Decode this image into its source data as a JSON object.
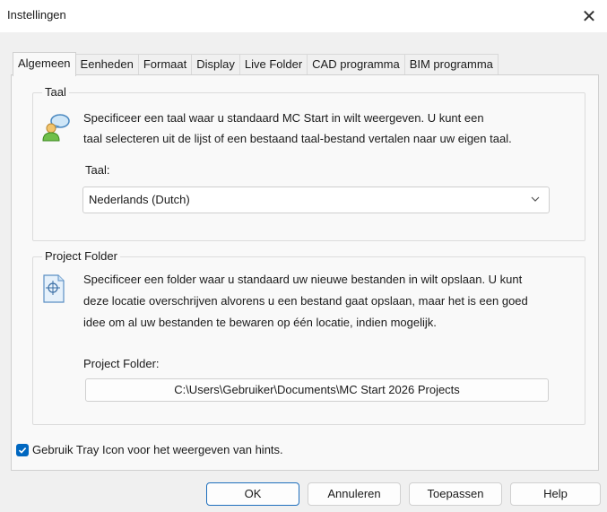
{
  "window": {
    "title": "Instellingen",
    "close_glyph": "✕"
  },
  "tabs": [
    {
      "label": "Algemeen",
      "active": true
    },
    {
      "label": "Eenheden"
    },
    {
      "label": "Formaat"
    },
    {
      "label": "Display"
    },
    {
      "label": "Live Folder"
    },
    {
      "label": "CAD programma"
    },
    {
      "label": "BIM programma"
    }
  ],
  "language": {
    "group_title": "Taal",
    "icon": "users-speech-icon",
    "desc_line1": "Specificeer een taal waar u standaard MC Start in wilt weergeven. U kunt een",
    "desc_line2": "taal selecteren uit de lijst of een bestaand taal-bestand vertalen naar uw eigen taal.",
    "field_label": "Taal:",
    "selected": "Nederlands (Dutch)"
  },
  "project": {
    "group_title": "Project Folder",
    "icon": "document-target-icon",
    "desc_line1": "Specificeer een folder waar u standaard uw nieuwe bestanden in wilt opslaan. U kunt",
    "desc_line2": "deze locatie overschrijven alvorens u een bestand gaat opslaan, maar het is een goed",
    "desc_line3": "idee om al uw bestanden te bewaren op één locatie, indien mogelijk.",
    "field_label": "Project Folder:",
    "path": "C:\\Users\\Gebruiker\\Documents\\MC Start 2026 Projects"
  },
  "tray": {
    "label": "Gebruik Tray Icon voor het weergeven van hints.",
    "checked": true
  },
  "buttons": {
    "ok": "OK",
    "cancel": "Annuleren",
    "apply": "Toepassen",
    "help": "Help"
  },
  "colors": {
    "accent": "#0067c0",
    "default_button_border": "#1f6fbd"
  }
}
